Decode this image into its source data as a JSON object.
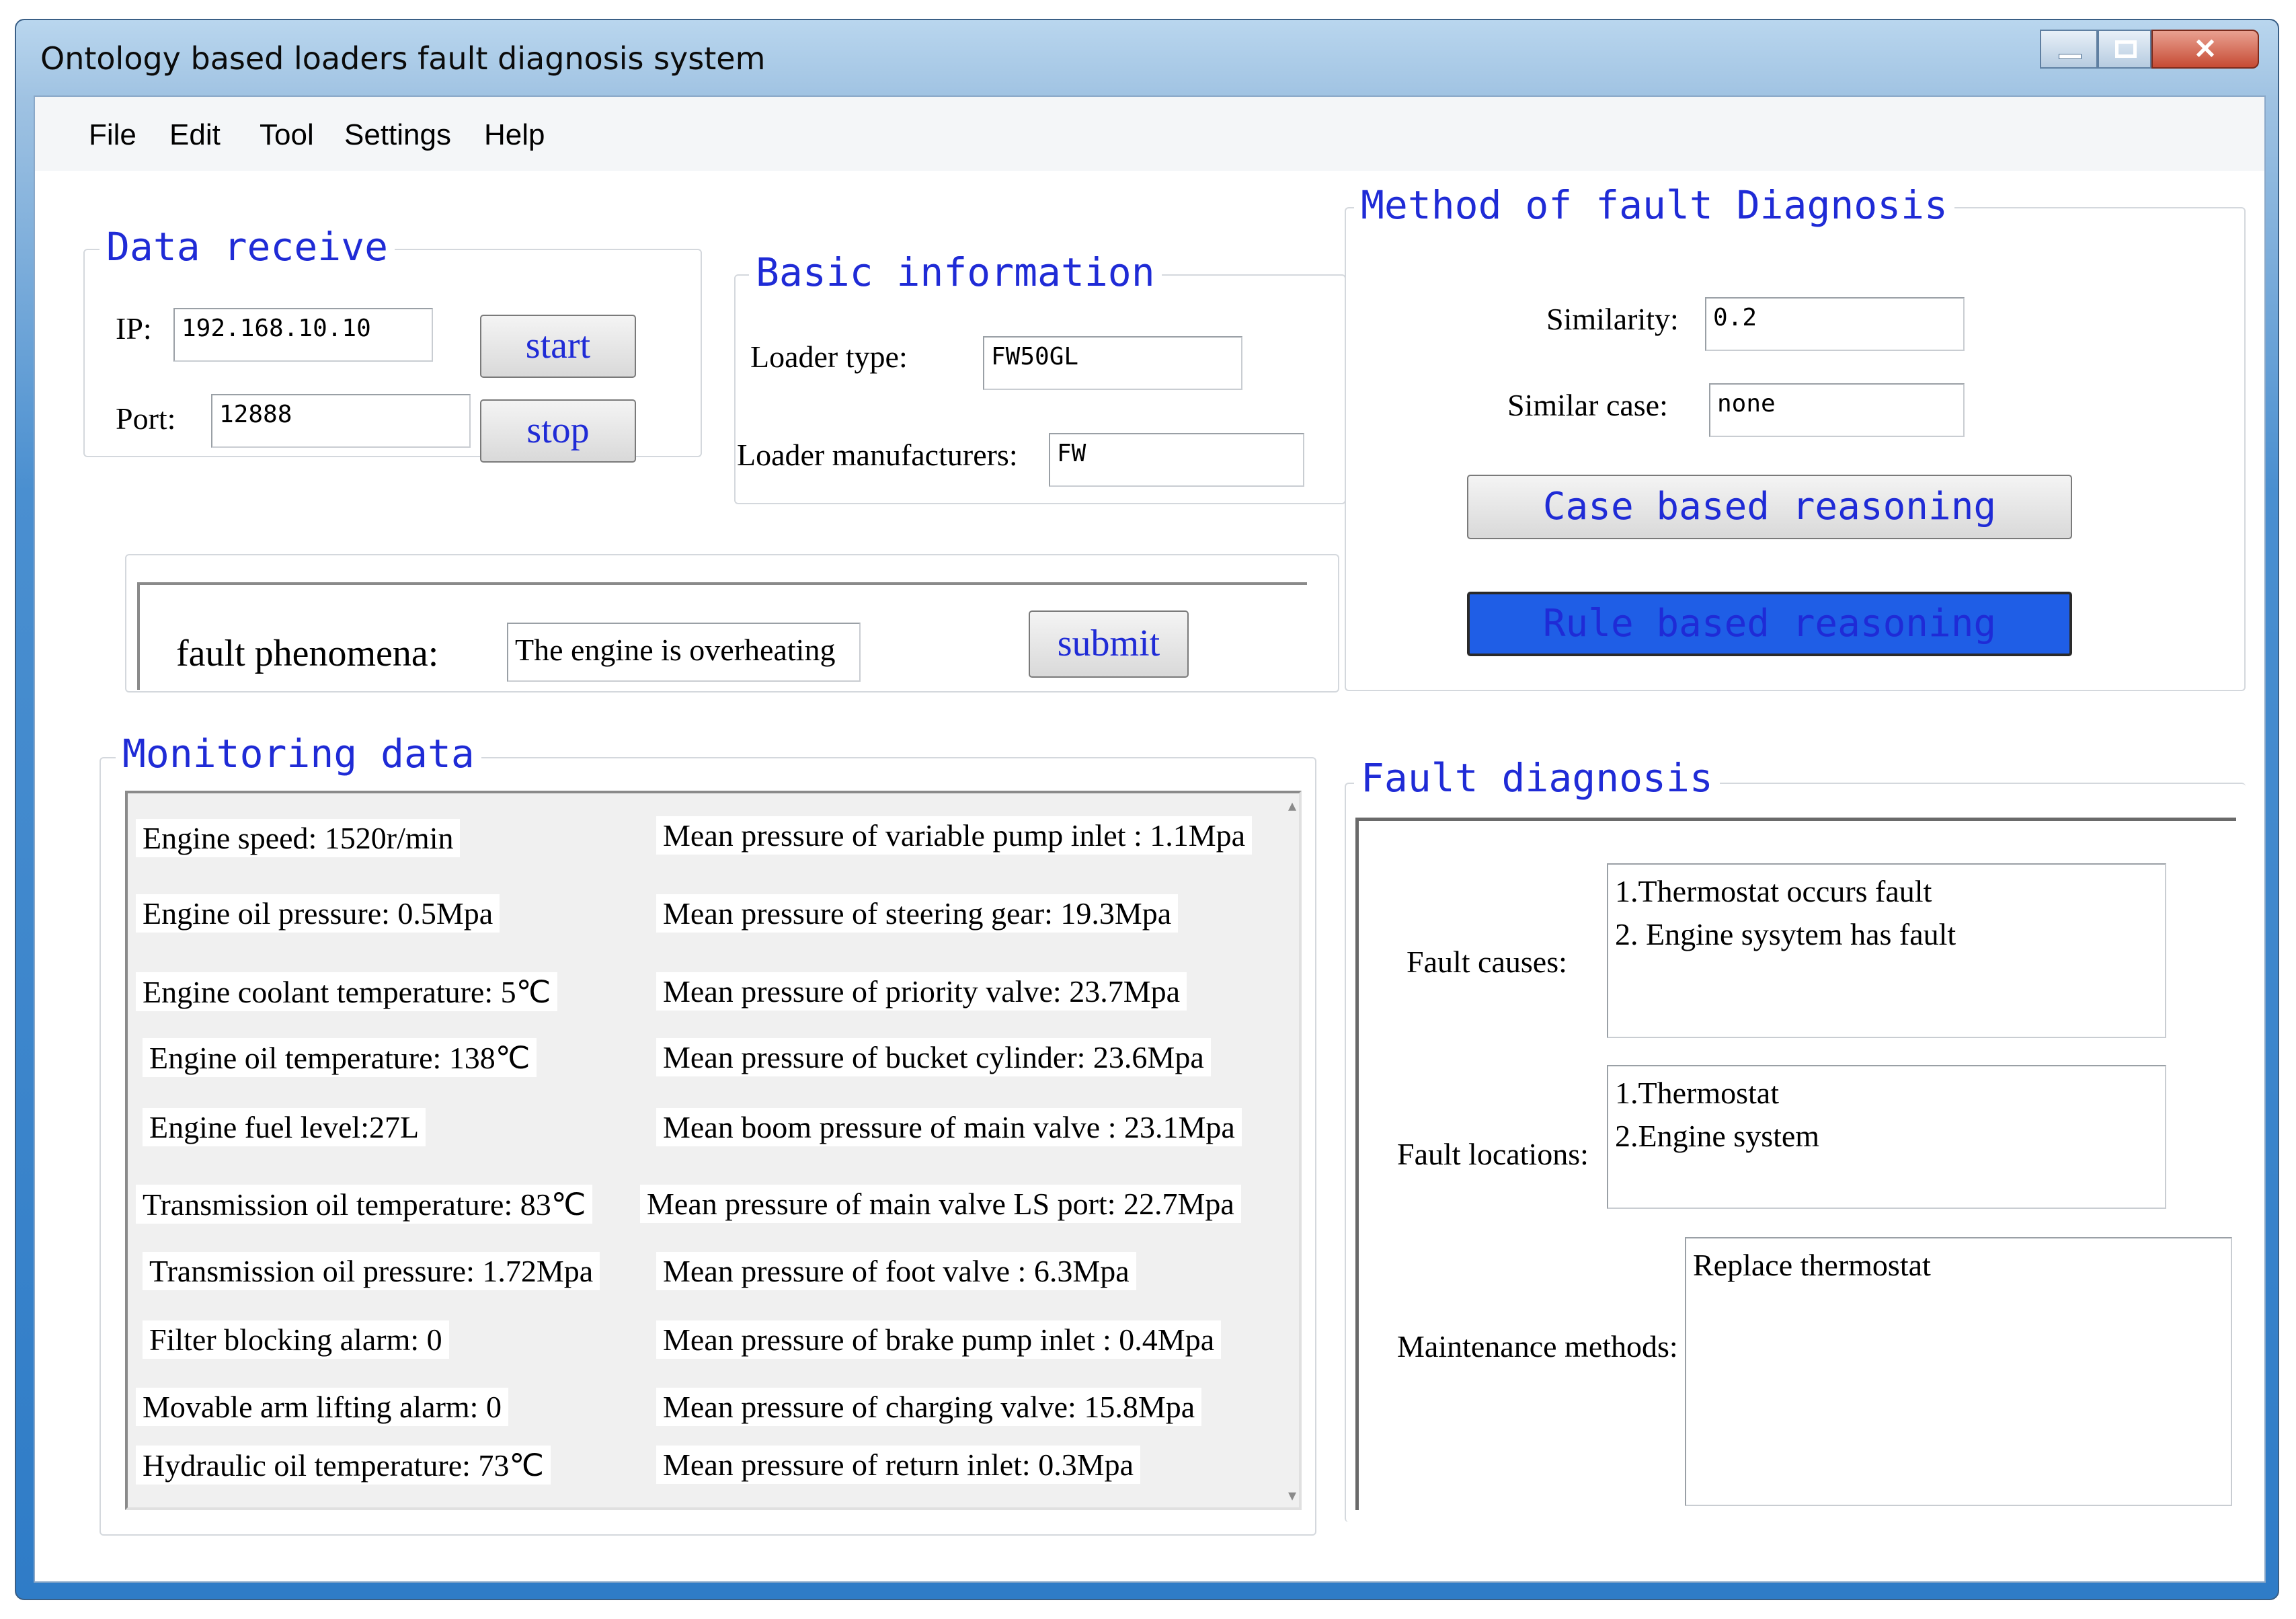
{
  "window": {
    "title": "Ontology based  loaders fault diagnosis system"
  },
  "menu": [
    "File",
    "Edit",
    "Tool",
    "Settings",
    "Help"
  ],
  "data_receive": {
    "legend": "Data receive",
    "ip_label": "IP:",
    "ip_value": "192.168.10.10",
    "port_label": "Port:",
    "port_value": "12888",
    "start_label": "start",
    "stop_label": "stop"
  },
  "basic_info": {
    "legend": "Basic information",
    "loader_type_label": "Loader type:",
    "loader_type_value": "FW50GL",
    "manufacturer_label": "Loader manufacturers:",
    "manufacturer_value": "FW"
  },
  "method": {
    "legend": "Method of fault Diagnosis",
    "similarity_label": "Similarity:",
    "similarity_value": "0.2",
    "similar_case_label": "Similar case:",
    "similar_case_value": "none",
    "case_button": "Case based reasoning",
    "rule_button": "Rule based reasoning"
  },
  "phenomena": {
    "label": "fault phenomena:",
    "value": "The engine is overheating",
    "submit_label": "submit"
  },
  "monitoring": {
    "legend": "Monitoring data",
    "left": [
      "Engine speed: 1520r/min",
      "Engine oil pressure: 0.5Mpa",
      "Engine coolant temperature: 5℃",
      "Engine oil temperature: 138℃",
      "Engine fuel level:27L",
      "Transmission oil temperature: 83℃",
      "Transmission oil pressure: 1.72Mpa",
      "Filter blocking alarm: 0",
      "Movable arm lifting alarm: 0",
      "Hydraulic oil temperature: 73℃"
    ],
    "right": [
      "Mean pressure of variable pump inlet : 1.1Mpa",
      "Mean pressure of steering gear: 19.3Mpa",
      "Mean pressure of priority valve: 23.7Mpa",
      "Mean pressure of bucket cylinder: 23.6Mpa",
      "Mean boom pressure of main valve : 23.1Mpa",
      "Mean pressure of main valve LS port: 22.7Mpa",
      "Mean pressure of foot valve : 6.3Mpa",
      "Mean pressure of brake pump inlet : 0.4Mpa",
      "Mean pressure of charging valve: 15.8Mpa",
      "Mean pressure of return inlet: 0.3Mpa"
    ]
  },
  "fault_diagnosis": {
    "legend": "Fault diagnosis",
    "causes_label": "Fault causes:",
    "causes": [
      "1.Thermostat occurs fault",
      "2. Engine sysytem has fault"
    ],
    "locations_label": "Fault locations:",
    "locations": [
      "1.Thermostat",
      "2.Engine system"
    ],
    "maintenance_label": "Maintenance methods:",
    "maintenance": [
      "Replace thermostat"
    ]
  },
  "colors": {
    "legend": "#1f2bd6",
    "rule_button_bg": "#1f5ee6",
    "window_frame": "#4a8fd0"
  }
}
